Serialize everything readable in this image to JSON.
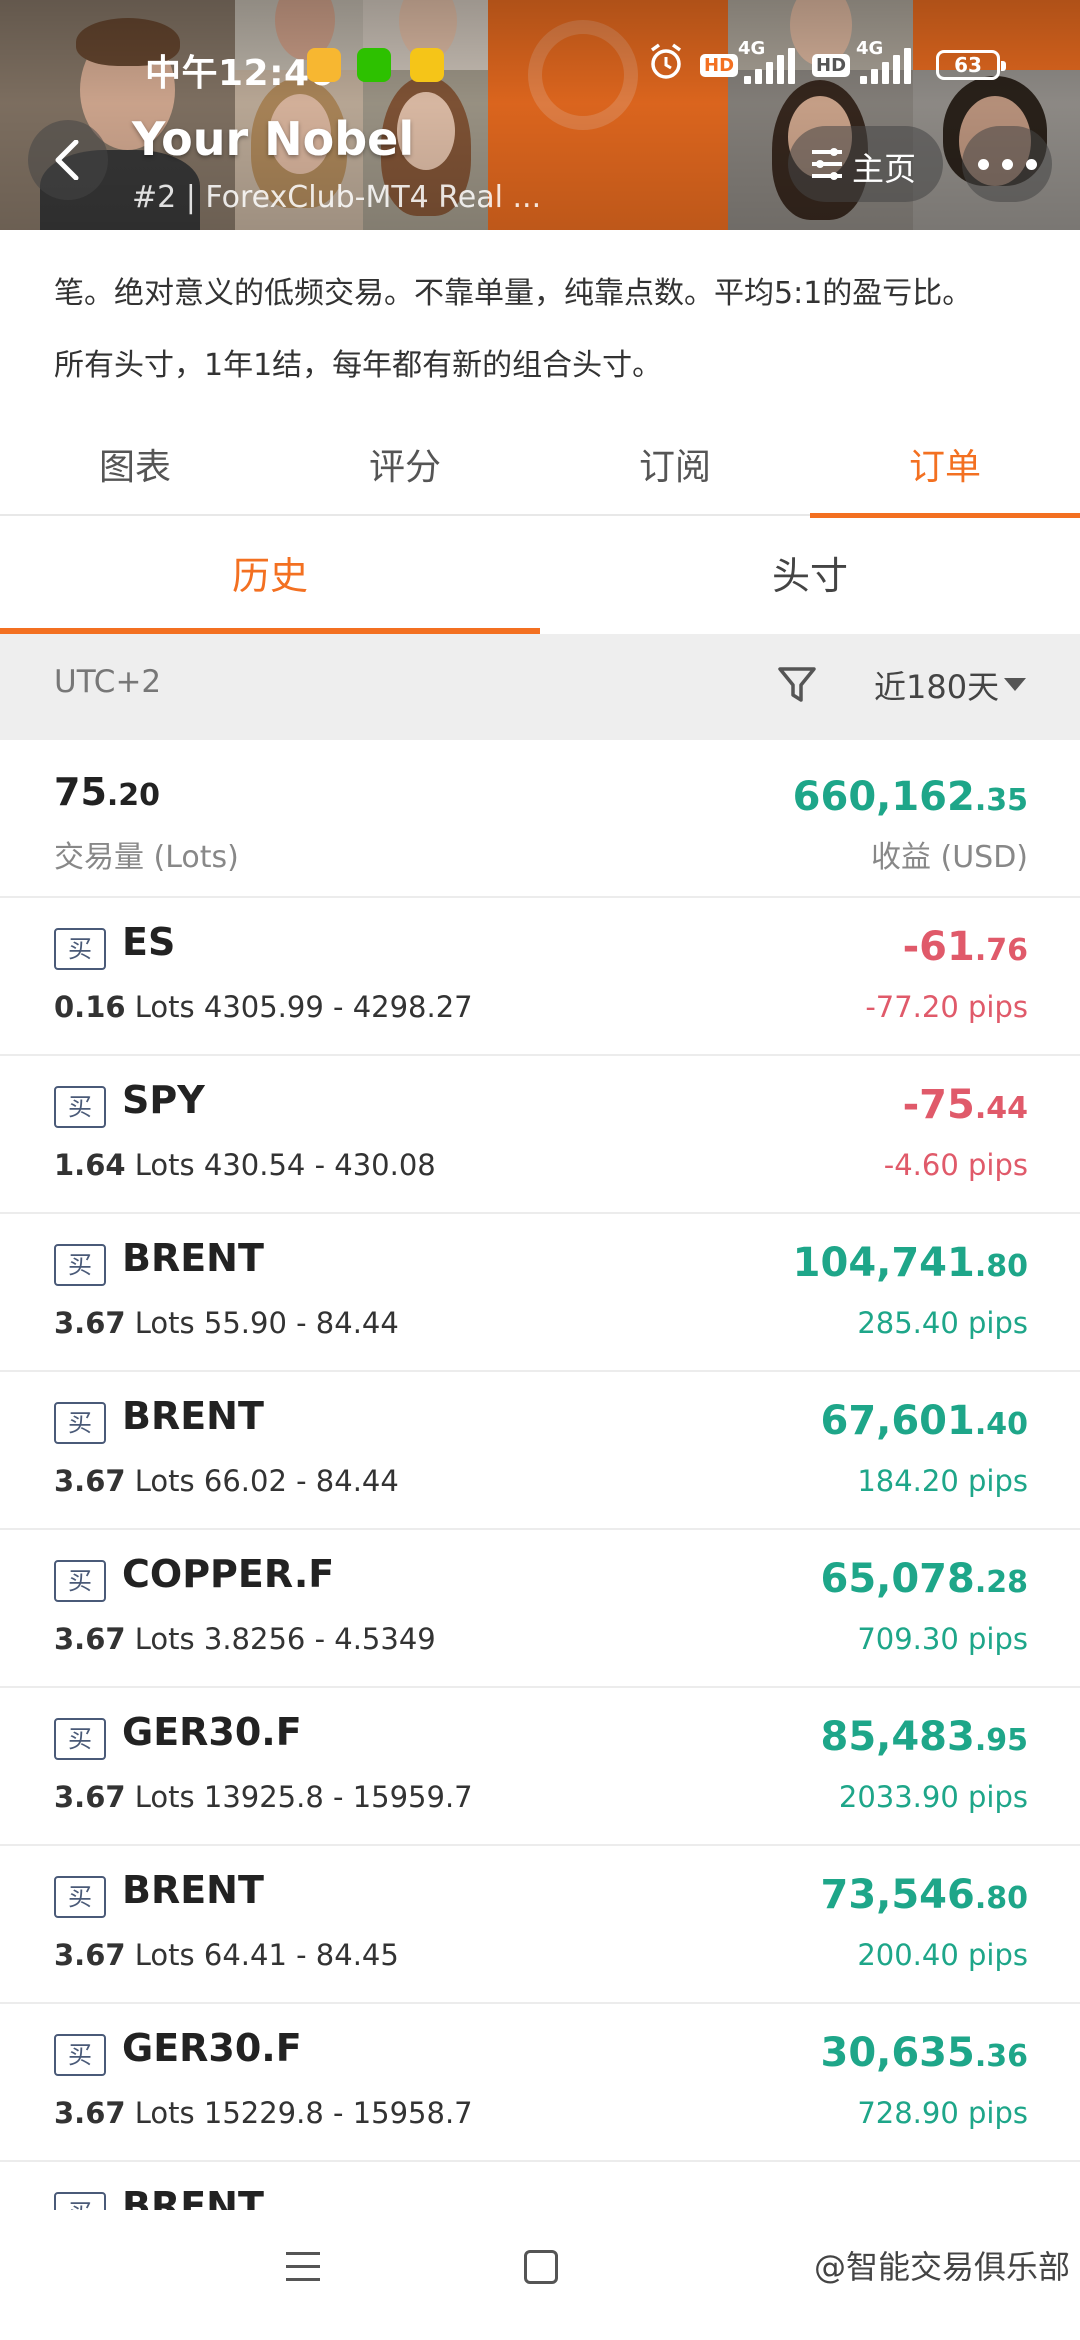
{
  "status_bar": {
    "time": "中午12:40",
    "battery": "63",
    "network_1": "4G",
    "network_2": "4G",
    "hd_1": "HD",
    "hd_2": "HD"
  },
  "account": {
    "name": "Your Nobel",
    "subtitle": "#2 | ForexClub-MT4 Real ...",
    "home_label": "主页"
  },
  "description": {
    "line1": "笔。绝对意义的低频交易。不靠单量，纯靠点数。平均5:1的盈亏比。",
    "line2": "所有头寸，1年1结，每年都有新的组合头寸。"
  },
  "tabs": [
    "图表",
    "评分",
    "订阅",
    "订单"
  ],
  "active_tab": "订单",
  "subtabs": [
    "历史",
    "头寸"
  ],
  "active_subtab": "历史",
  "filter": {
    "timezone": "UTC+2",
    "range": "近180天"
  },
  "summary": {
    "lots_main": "75",
    "lots_dec": ".20",
    "lots_label": "交易量 (Lots)",
    "profit_main": "660,162",
    "profit_dec": ".35",
    "profit_label": "收益 (USD)"
  },
  "orders": [
    {
      "side": "买",
      "symbol": "ES",
      "lots": "0.16",
      "lots_unit": "Lots",
      "prices": "4305.99 - 4298.27",
      "profit_main": "-61",
      "profit_dec": ".76",
      "pips": "-77.20 pips",
      "direction": "neg"
    },
    {
      "side": "买",
      "symbol": "SPY",
      "lots": "1.64",
      "lots_unit": "Lots",
      "prices": "430.54 - 430.08",
      "profit_main": "-75",
      "profit_dec": ".44",
      "pips": "-4.60 pips",
      "direction": "neg"
    },
    {
      "side": "买",
      "symbol": "BRENT",
      "lots": "3.67",
      "lots_unit": "Lots",
      "prices": "55.90 - 84.44",
      "profit_main": "104,741",
      "profit_dec": ".80",
      "pips": "285.40 pips",
      "direction": "pos"
    },
    {
      "side": "买",
      "symbol": "BRENT",
      "lots": "3.67",
      "lots_unit": "Lots",
      "prices": "66.02 - 84.44",
      "profit_main": "67,601",
      "profit_dec": ".40",
      "pips": "184.20 pips",
      "direction": "pos"
    },
    {
      "side": "买",
      "symbol": "COPPER.F",
      "lots": "3.67",
      "lots_unit": "Lots",
      "prices": "3.8256 - 4.5349",
      "profit_main": "65,078",
      "profit_dec": ".28",
      "pips": "709.30 pips",
      "direction": "pos"
    },
    {
      "side": "买",
      "symbol": "GER30.F",
      "lots": "3.67",
      "lots_unit": "Lots",
      "prices": "13925.8 - 15959.7",
      "profit_main": "85,483",
      "profit_dec": ".95",
      "pips": "2033.90 pips",
      "direction": "pos"
    },
    {
      "side": "买",
      "symbol": "BRENT",
      "lots": "3.67",
      "lots_unit": "Lots",
      "prices": "64.41 - 84.45",
      "profit_main": "73,546",
      "profit_dec": ".80",
      "pips": "200.40 pips",
      "direction": "pos"
    },
    {
      "side": "买",
      "symbol": "GER30.F",
      "lots": "3.67",
      "lots_unit": "Lots",
      "prices": "15229.8 - 15958.7",
      "profit_main": "30,635",
      "profit_dec": ".36",
      "pips": "728.90 pips",
      "direction": "pos"
    },
    {
      "side": "买",
      "symbol": "BRENT",
      "lots": "",
      "lots_unit": "",
      "prices": "",
      "profit_main": "",
      "profit_dec": "",
      "pips": "",
      "direction": "pos"
    }
  ],
  "watermark": "@智能交易俱乐部",
  "colors": {
    "accent": "#f37021",
    "profit_positive": "#1ea689",
    "profit_negative": "#e05a6a"
  },
  "icons": [
    "back-arrow-icon",
    "menu-lines-icon",
    "more-dots-icon",
    "filter-funnel-icon",
    "caret-down-icon",
    "alarm-icon",
    "wechat-icon",
    "message-icon",
    "mail-icon"
  ]
}
